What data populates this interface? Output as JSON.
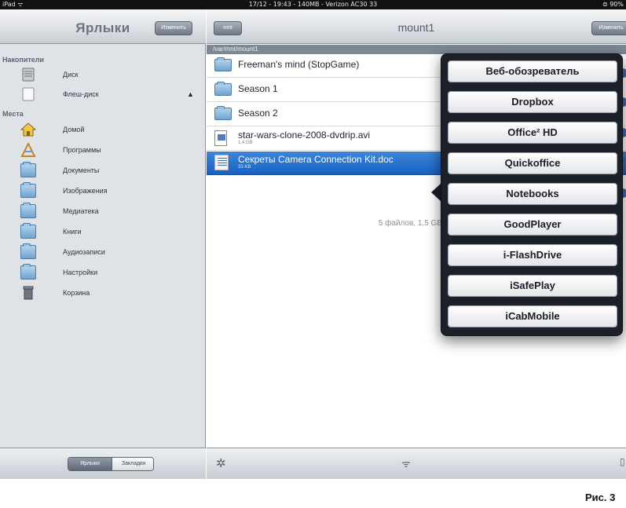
{
  "status_bar": {
    "left": "iPad ᯤ",
    "center": "17/12 - 19:43 - 140MB - Verizon AC30 33",
    "right": "⊜ 90%"
  },
  "sidebar": {
    "title": "Ярлыки",
    "edit_label": "Изменить",
    "section_drives": "Накопители",
    "drives": [
      {
        "label": "Диск"
      },
      {
        "label": "Флеш-диск"
      }
    ],
    "section_places": "Места",
    "places": [
      {
        "label": "Домой"
      },
      {
        "label": "Программы"
      },
      {
        "label": "Документы"
      },
      {
        "label": "Изображения"
      },
      {
        "label": "Медиатека"
      },
      {
        "label": "Книги"
      },
      {
        "label": "Аудиозаписи"
      },
      {
        "label": "Настройки"
      },
      {
        "label": "Корзина"
      }
    ],
    "footer_tabs": [
      "Ярлыки",
      "Закладки"
    ]
  },
  "main": {
    "back_label": "mnt",
    "title": "mount1",
    "edit_label": "Изменить",
    "path": "/var/mnt/mount1",
    "files": [
      {
        "name": "Freeman's mind (StopGame)",
        "size": ""
      },
      {
        "name": "Season 1",
        "size": ""
      },
      {
        "name": "Season 2",
        "size": ""
      },
      {
        "name": "star-wars-clone-2008-dvdrip.avi",
        "size": "1,4 GB"
      },
      {
        "name": "Секреты Camera Connection Kit.doc",
        "size": "33 KB"
      }
    ],
    "summary": "5 файлов, 1,5 GB"
  },
  "popover": {
    "items": [
      "Веб-обозреватель",
      "Dropbox",
      "Office² HD",
      "Quickoffice",
      "Notebooks",
      "GoodPlayer",
      "i-FlashDrive",
      "iSafePlay",
      "iCabMobile"
    ]
  },
  "caption": "Рис. 3"
}
